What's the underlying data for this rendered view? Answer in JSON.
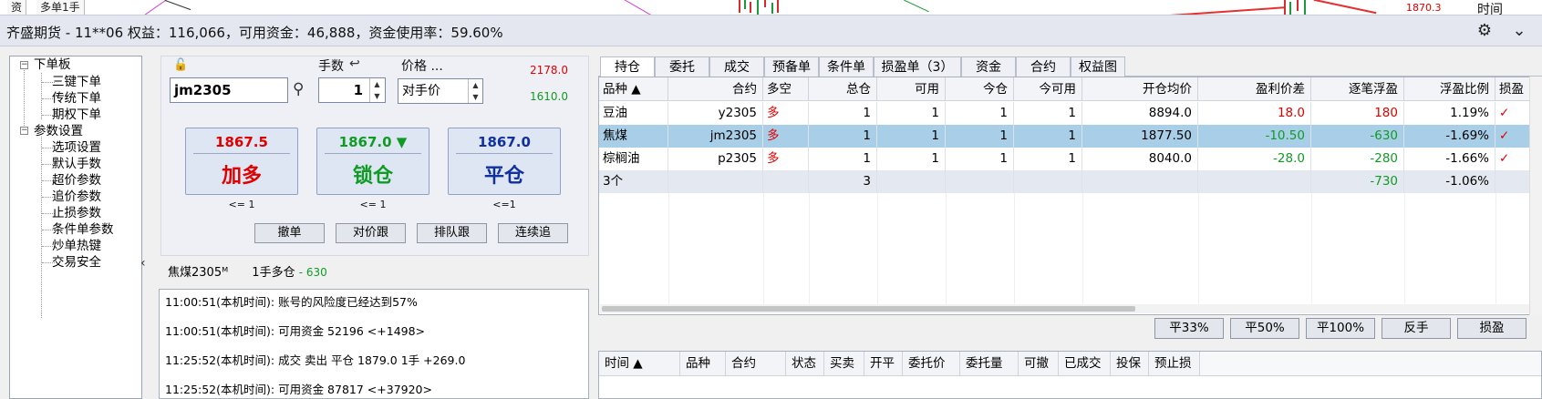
{
  "top_strip": {
    "tab1": "资",
    "tab2": "多单1手",
    "right_label": "时间",
    "price_label": "1870.3"
  },
  "header": {
    "title": "齐盛期货 - 11**06 权益：116,066，可用资金：46,888，资金使用率：59.60%"
  },
  "tree": {
    "groups": [
      {
        "label": "下单板",
        "children": [
          "三键下单",
          "传统下单",
          "期权下单"
        ]
      },
      {
        "label": "参数设置",
        "children": [
          "选项设置",
          "默认手数",
          "超价参数",
          "追价参数",
          "止损参数",
          "条件单参数",
          "炒单热键",
          "交易安全"
        ]
      }
    ]
  },
  "order": {
    "symbol": "jm2305",
    "qty_label": "手数",
    "qty": "1",
    "price_label": "价格 ...",
    "price_mode": "对手价",
    "upper_limit": "2178.0",
    "lower_limit": "1610.0",
    "buttons": [
      {
        "price": "1867.5",
        "action": "加多",
        "limit": "<= 1",
        "color": "#e00000"
      },
      {
        "price": "1867.0 ▼",
        "action": "锁仓",
        "limit": "<= 1",
        "color": "#109b24"
      },
      {
        "price": "1867.0",
        "action": "平仓",
        "limit": "<=1",
        "color": "#1030a0"
      }
    ],
    "small_buttons": [
      "撤单",
      "对价跟",
      "排队跟",
      "连续追"
    ]
  },
  "status": {
    "name": "焦煤2305ᴹ",
    "position": "1手多仓",
    "pnl": "- 630"
  },
  "log": [
    "11:00:51(本机时间): 账号的风险度已经达到57%",
    "11:00:51(本机时间): 可用资金 52196  <+1498>",
    "11:25:52(本机时间): 成交  卖出  平仓  1879.0  1手  +269.0",
    "11:25:52(本机时间): 可用资金 87817  <+37920>"
  ],
  "position_tabs": [
    "持仓",
    "委托",
    "成交",
    "预备单",
    "条件单",
    "损盈单（3）",
    "资金",
    "合约",
    "权益图"
  ],
  "positions": {
    "headers": [
      "品种 ▲",
      "合约",
      "多空",
      "总仓",
      "可用",
      "今仓",
      "今可用",
      "开仓均价",
      "盈利价差",
      "逐笔浮盈",
      "浮盈比例",
      "损盈"
    ],
    "rows": [
      {
        "variety": "豆油",
        "contract": "y2305",
        "side": "多",
        "total": "1",
        "avail": "1",
        "today": "1",
        "today_avail": "1",
        "open_avg": "8894.0",
        "spread": "18.0",
        "float_pnl": "180",
        "ratio": "1.19%",
        "sl": "✓",
        "pnl_sign": "red"
      },
      {
        "variety": "焦煤",
        "contract": "jm2305",
        "side": "多",
        "total": "1",
        "avail": "1",
        "today": "1",
        "today_avail": "1",
        "open_avg": "1877.50",
        "spread": "-10.50",
        "float_pnl": "-630",
        "ratio": "-1.69%",
        "sl": "✓",
        "pnl_sign": "green"
      },
      {
        "variety": "棕榈油",
        "contract": "p2305",
        "side": "多",
        "total": "1",
        "avail": "1",
        "today": "1",
        "today_avail": "1",
        "open_avg": "8040.0",
        "spread": "-28.0",
        "float_pnl": "-280",
        "ratio": "-1.66%",
        "sl": "✓",
        "pnl_sign": "green"
      }
    ],
    "summary": {
      "count": "3个",
      "total": "3",
      "float_pnl": "-730",
      "ratio": "-1.06%"
    }
  },
  "actions": [
    "平33%",
    "平50%",
    "平100%",
    "反手",
    "损盈"
  ],
  "orders_headers": [
    "时间 ▲",
    "品种",
    "合约",
    "状态",
    "买卖",
    "开平",
    "委托价",
    "委托量",
    "可撤",
    "已成交",
    "投保",
    "预止损"
  ],
  "colors": {
    "profit": "#e00000",
    "loss": "#109b24",
    "selected_row": "#a9cfe8",
    "header_bg": "#e4e7ef"
  }
}
